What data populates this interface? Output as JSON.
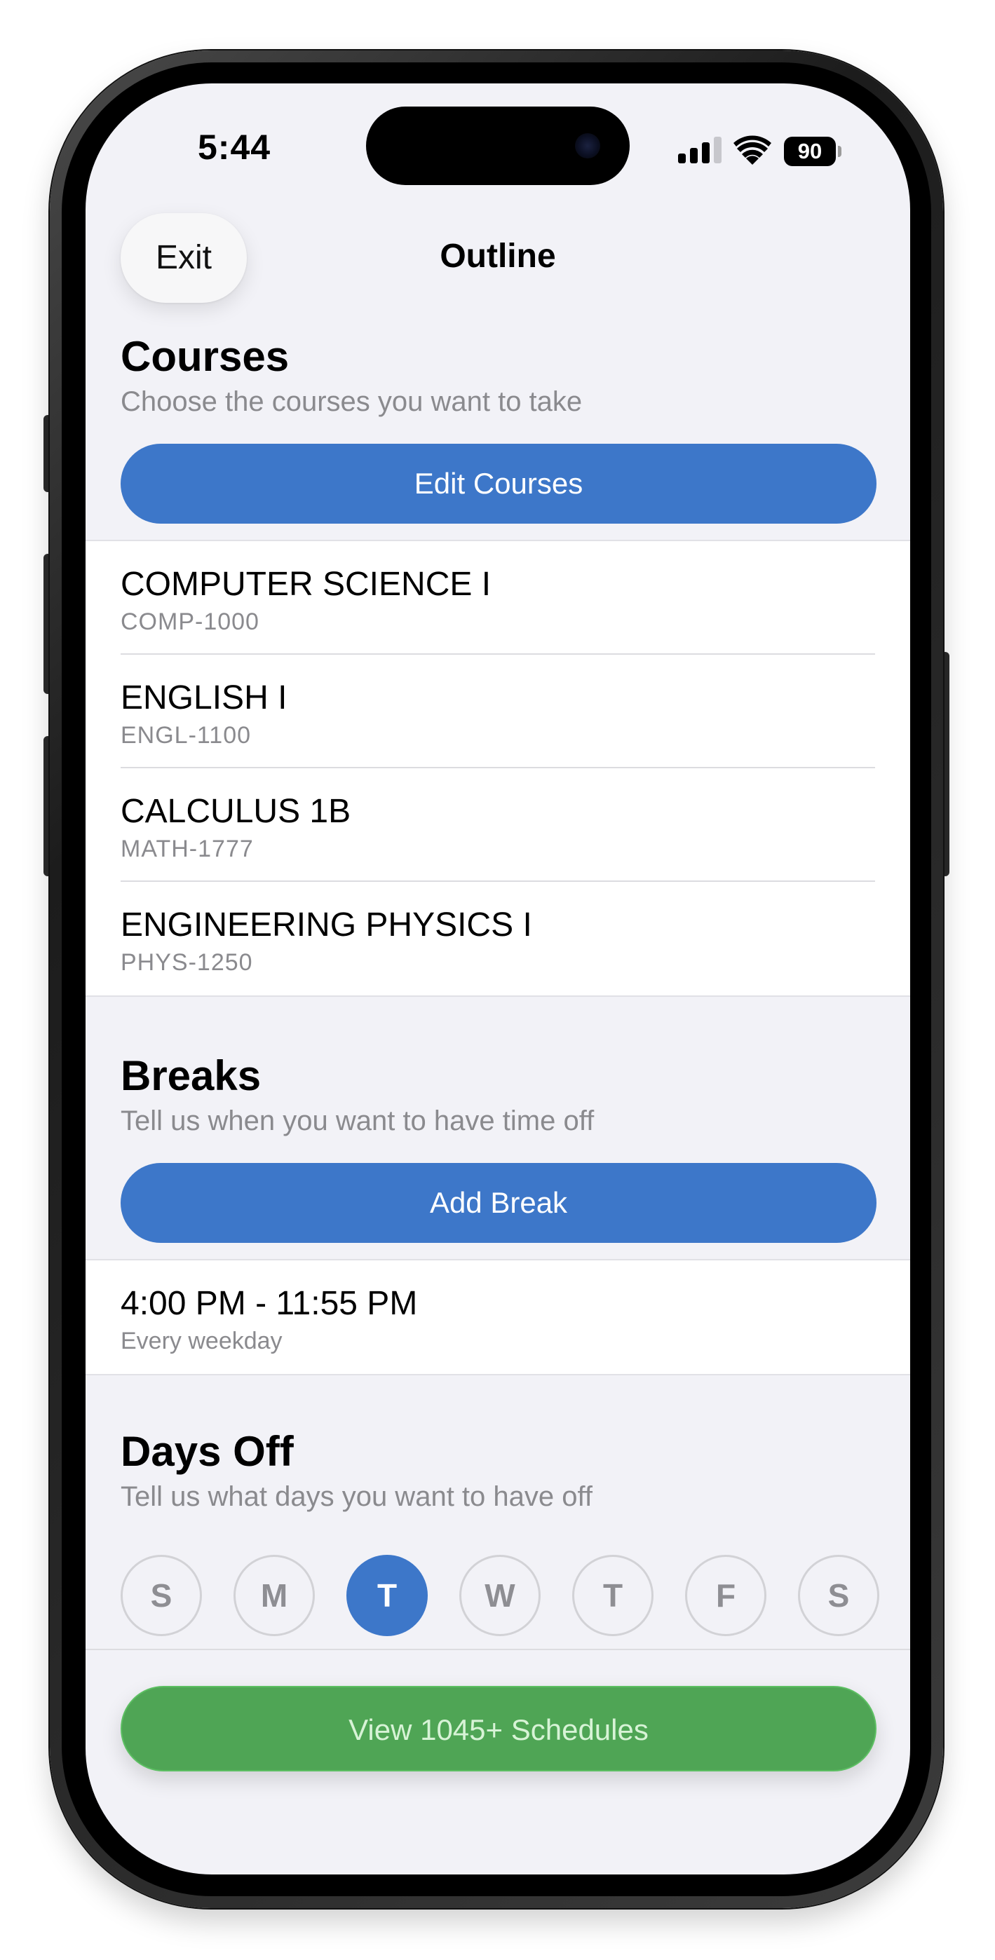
{
  "status_bar": {
    "time": "5:44",
    "battery": "90"
  },
  "nav": {
    "exit_label": "Exit",
    "title": "Outline"
  },
  "courses": {
    "title": "Courses",
    "subtitle": "Choose the courses you want to take",
    "button_label": "Edit Courses",
    "items": [
      {
        "name": "COMPUTER SCIENCE I",
        "code": "COMP-1000"
      },
      {
        "name": "ENGLISH I",
        "code": "ENGL-1100"
      },
      {
        "name": "CALCULUS 1B",
        "code": "MATH-1777"
      },
      {
        "name": "ENGINEERING PHYSICS I",
        "code": "PHYS-1250"
      }
    ]
  },
  "breaks": {
    "title": "Breaks",
    "subtitle": "Tell us when you want to have time off",
    "button_label": "Add Break",
    "items": [
      {
        "time": "4:00 PM - 11:55 PM",
        "recurrence": "Every weekday"
      }
    ]
  },
  "days_off": {
    "title": "Days Off",
    "subtitle": "Tell us what days you want to have off",
    "days": [
      {
        "letter": "S",
        "selected": false
      },
      {
        "letter": "M",
        "selected": false
      },
      {
        "letter": "T",
        "selected": true
      },
      {
        "letter": "W",
        "selected": false
      },
      {
        "letter": "T",
        "selected": false
      },
      {
        "letter": "F",
        "selected": false
      },
      {
        "letter": "S",
        "selected": false
      }
    ]
  },
  "footer": {
    "schedules_label": "View 1045+ Schedules"
  },
  "colors": {
    "accent_blue": "#3d77c9",
    "accent_green": "#4fa555",
    "background": "#f2f2f7"
  },
  "icons": [
    "signal-icon",
    "wifi-icon",
    "battery-icon"
  ]
}
